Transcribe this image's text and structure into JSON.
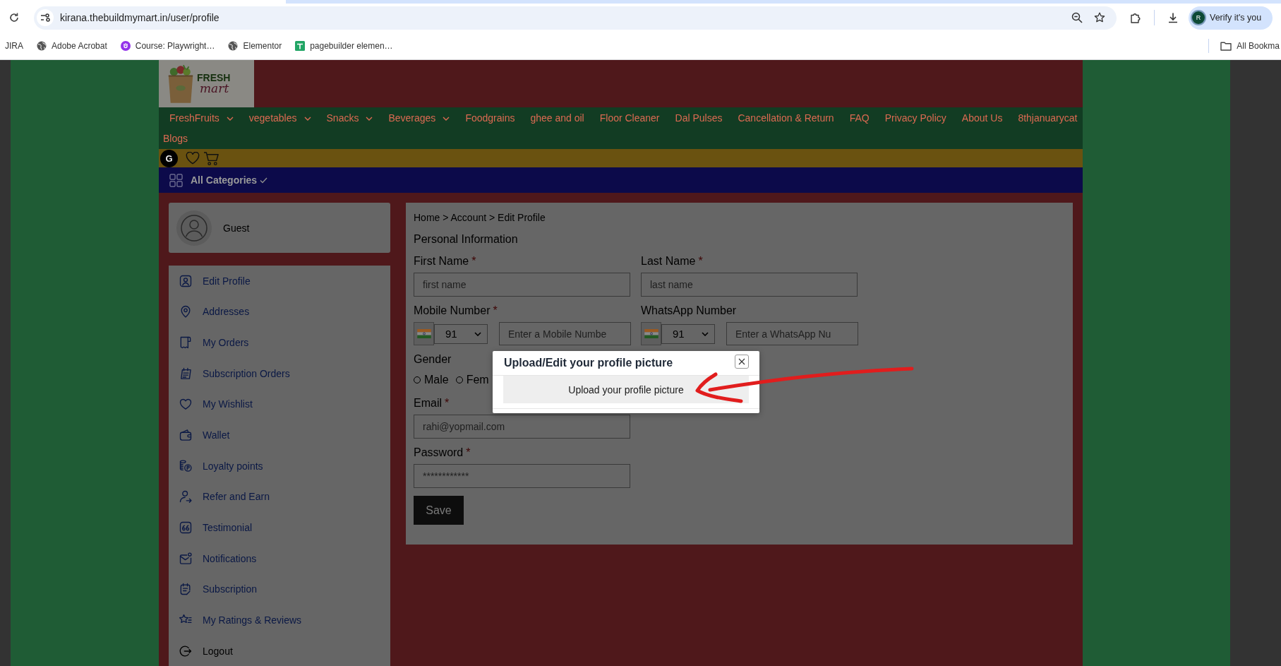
{
  "browser": {
    "url": "kirana.thebuildmymart.in/user/profile",
    "profile_initial": "R",
    "profile_label": "Verify it's you",
    "bookmarks": [
      {
        "label": "JIRA",
        "kind": "plain"
      },
      {
        "label": "Adobe Acrobat",
        "kind": "globe"
      },
      {
        "label": "Course: Playwright…",
        "kind": "course"
      },
      {
        "label": "Elementor",
        "kind": "globe"
      },
      {
        "label": "pagebuilder elemen…",
        "kind": "sheet"
      }
    ],
    "all_bookmarks": "All Bookma"
  },
  "site": {
    "logo": {
      "word": "FRESH",
      "script": "mart"
    },
    "nav": [
      {
        "label": "FreshFruits",
        "dropdown": true
      },
      {
        "label": "vegetables",
        "dropdown": true
      },
      {
        "label": "Snacks",
        "dropdown": true
      },
      {
        "label": "Beverages",
        "dropdown": true
      },
      {
        "label": "Foodgrains",
        "dropdown": false
      },
      {
        "label": "ghee and oil",
        "dropdown": false
      },
      {
        "label": "Floor Cleaner",
        "dropdown": false
      },
      {
        "label": "Dal Pulses",
        "dropdown": false
      },
      {
        "label": "Cancellation & Return",
        "dropdown": false
      },
      {
        "label": "FAQ",
        "dropdown": false
      },
      {
        "label": "Privacy Policy",
        "dropdown": false
      },
      {
        "label": "About Us",
        "dropdown": false
      },
      {
        "label": "8thjanuarycat",
        "dropdown": false
      },
      {
        "label": "Blogs",
        "dropdown": false
      }
    ],
    "user_initial": "G",
    "categories": "All Categories"
  },
  "sidebar": {
    "user_name": "Guest",
    "menu": [
      {
        "label": "Edit Profile",
        "kind": "profile"
      },
      {
        "label": "Addresses",
        "kind": "addresses"
      },
      {
        "label": "My Orders",
        "kind": "orders"
      },
      {
        "label": "Subscription Orders",
        "kind": "subscription_orders"
      },
      {
        "label": "My Wishlist",
        "kind": "wishlist"
      },
      {
        "label": "Wallet",
        "kind": "wallet"
      },
      {
        "label": "Loyalty points",
        "kind": "loyalty"
      },
      {
        "label": "Refer and Earn",
        "kind": "refer"
      },
      {
        "label": "Testimonial",
        "kind": "testimonial"
      },
      {
        "label": "Notifications",
        "kind": "notifications"
      },
      {
        "label": "Subscription",
        "kind": "subscription"
      },
      {
        "label": "My Ratings & Reviews",
        "kind": "ratings"
      },
      {
        "label": "Logout",
        "kind": "logout"
      }
    ]
  },
  "profile_form": {
    "breadcrumb": "Home > Account > Edit Profile",
    "title": "Personal Information",
    "rows": [
      {
        "fields": [
          {
            "kind": "text",
            "label": "First Name",
            "asterisk": "*",
            "placeholder": "first name"
          },
          {
            "kind": "text",
            "label": "Last Name",
            "asterisk": "*",
            "placeholder": "last name"
          }
        ]
      },
      {
        "fields": [
          {
            "kind": "phone",
            "label": "Mobile Number",
            "asterisk": "*",
            "code": "91",
            "placeholder": "Enter a Mobile Numbe"
          },
          {
            "kind": "phone",
            "label": "WhatsApp Number",
            "code": "91",
            "placeholder": "Enter a WhatsApp Nu"
          }
        ]
      },
      {
        "fields": [
          {
            "kind": "radio",
            "label": "Gender",
            "options": [
              {
                "label": "Male",
                "selected": false
              },
              {
                "label": "Fem",
                "selected": false
              }
            ]
          }
        ]
      },
      {
        "fields": [
          {
            "kind": "text",
            "label": "Email",
            "asterisk": "*",
            "value": "rahi@yopmail.com"
          }
        ]
      },
      {
        "fields": [
          {
            "kind": "text",
            "label": "Password",
            "asterisk": "*",
            "value": "************"
          }
        ]
      }
    ],
    "save": "Save"
  },
  "dialog": {
    "title": "Upload/Edit your profile picture",
    "upload_button": "Upload your profile picture"
  }
}
